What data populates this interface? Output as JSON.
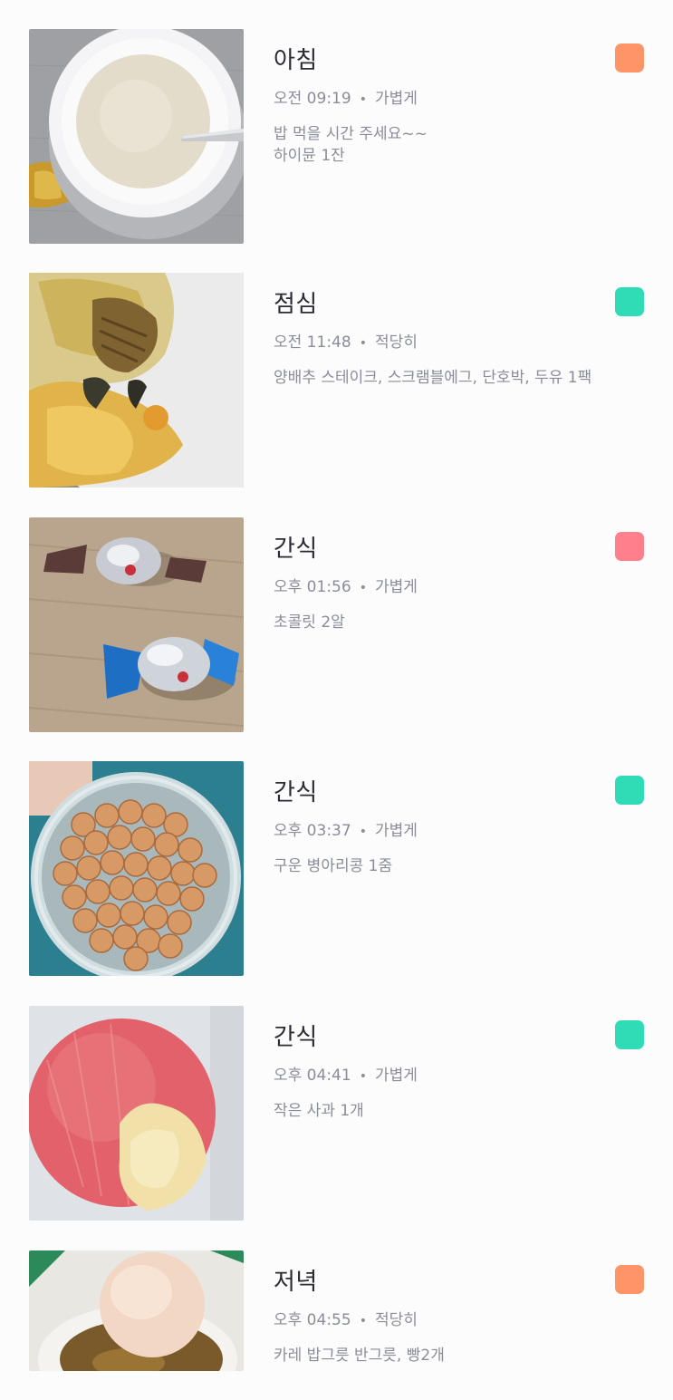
{
  "colors": {
    "orange": "#ff9466",
    "teal": "#2fdcb6",
    "pink": "#ff7f8c"
  },
  "entries": [
    {
      "meal": "아침",
      "time": "오전 09:19",
      "portion": "가볍게",
      "memo": "밥 먹을 시간 주세요~~\n하이뮨 1잔",
      "badge_color": "#ff9466",
      "photo": "protein-powder-cup-photo"
    },
    {
      "meal": "점심",
      "time": "오전 11:48",
      "portion": "적당히",
      "memo": "양배추 스테이크, 스크램블에그, 단호박, 두유 1팩",
      "badge_color": "#2fdcb6",
      "photo": "cabbage-steak-egg-plate-photo"
    },
    {
      "meal": "간식",
      "time": "오후 01:56",
      "portion": "가볍게",
      "memo": "초콜릿 2알",
      "badge_color": "#ff7f8c",
      "photo": "wrapped-chocolates-photo"
    },
    {
      "meal": "간식",
      "time": "오후 03:37",
      "portion": "가볍게",
      "memo": "구운 병아리콩 1줌",
      "badge_color": "#2fdcb6",
      "photo": "roasted-chickpeas-jar-photo"
    },
    {
      "meal": "간식",
      "time": "오후 04:41",
      "portion": "가볍게",
      "memo": "작은 사과 1개",
      "badge_color": "#2fdcb6",
      "photo": "bitten-apple-photo"
    },
    {
      "meal": "저녁",
      "time": "오후 04:55",
      "portion": "적당히",
      "memo": "카레 밥그릇 반그릇, 빵2개",
      "badge_color": "#ff9466",
      "photo": "bread-curry-photo"
    }
  ]
}
